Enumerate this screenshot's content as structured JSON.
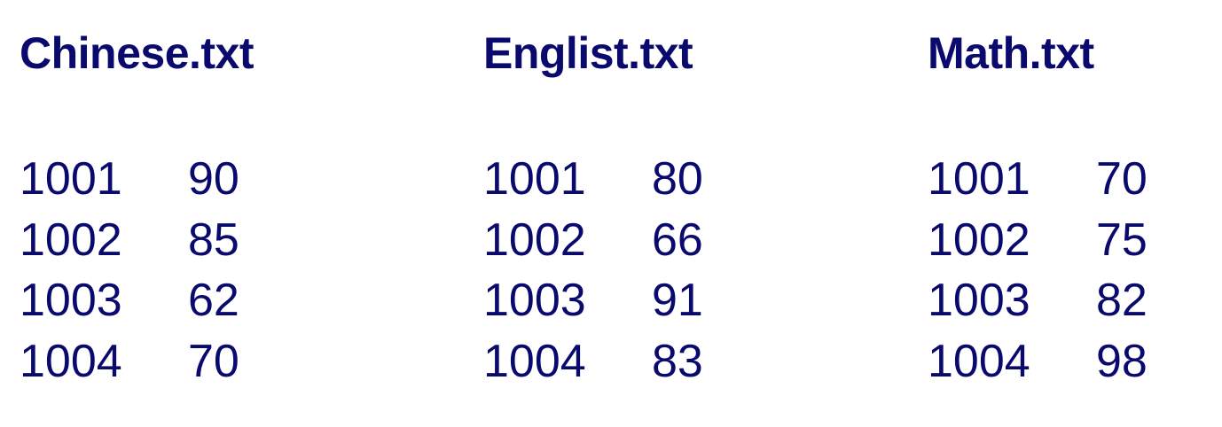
{
  "files": [
    {
      "title": "Chinese.txt",
      "rows": [
        {
          "id": "1001",
          "score": "90"
        },
        {
          "id": "1002",
          "score": "85"
        },
        {
          "id": "1003",
          "score": "62"
        },
        {
          "id": "1004",
          "score": "70"
        }
      ]
    },
    {
      "title": "Englist.txt",
      "rows": [
        {
          "id": "1001",
          "score": "80"
        },
        {
          "id": "1002",
          "score": "66"
        },
        {
          "id": "1003",
          "score": "91"
        },
        {
          "id": "1004",
          "score": "83"
        }
      ]
    },
    {
      "title": "Math.txt",
      "rows": [
        {
          "id": "1001",
          "score": "70"
        },
        {
          "id": "1002",
          "score": "75"
        },
        {
          "id": "1003",
          "score": "82"
        },
        {
          "id": "1004",
          "score": "98"
        }
      ]
    }
  ],
  "colors": {
    "text": "#0a0a6e",
    "background": "#ffffff"
  }
}
